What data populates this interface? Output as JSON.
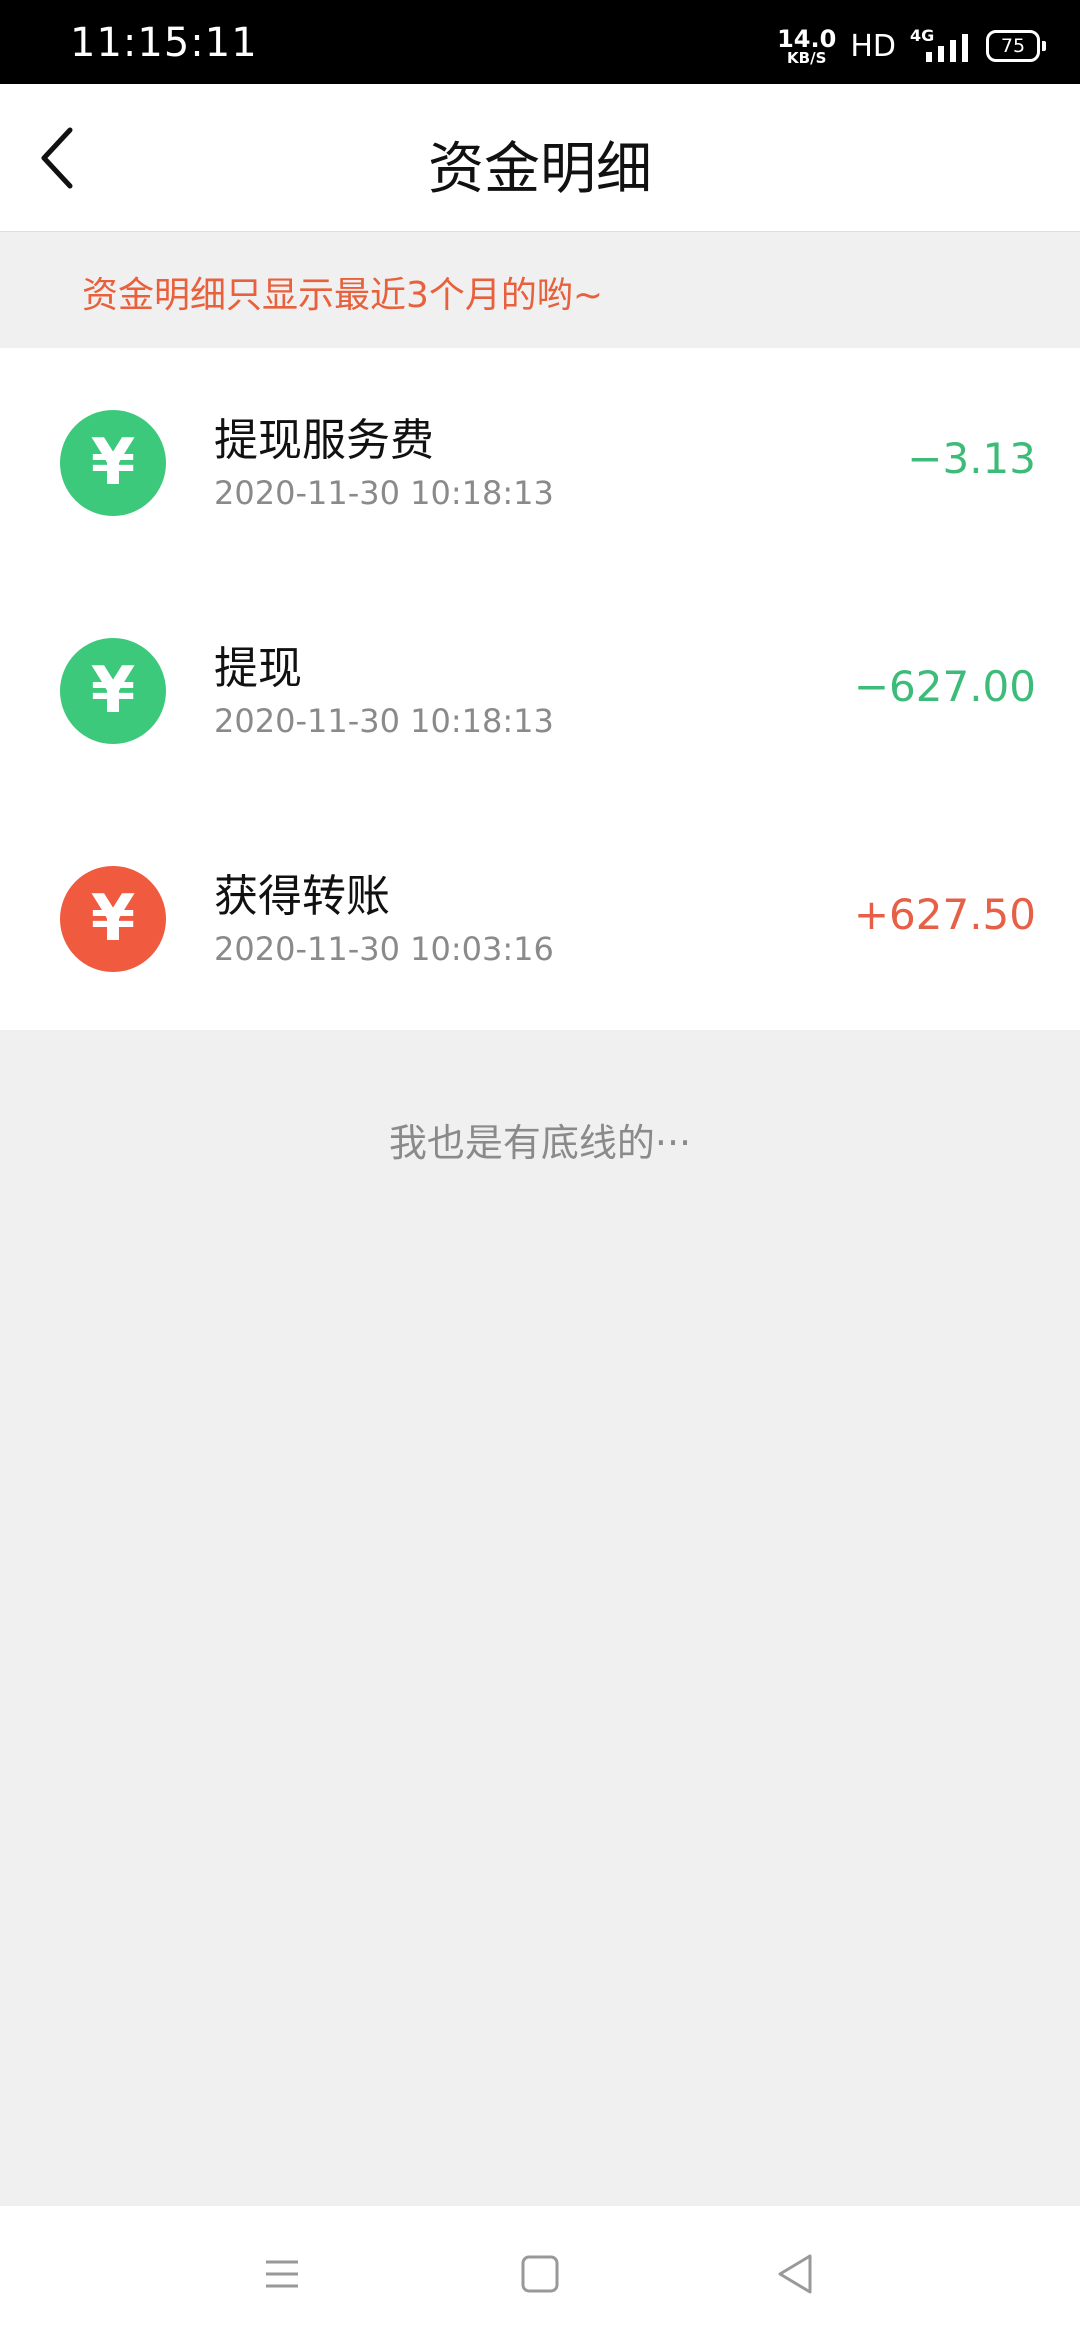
{
  "status_bar": {
    "time": "11:15:11",
    "net_speed_value": "14.0",
    "net_speed_unit": "KB/S",
    "hd": "HD",
    "network": "4G",
    "battery": "75"
  },
  "header": {
    "title": "资金明细",
    "back_icon": "chevron-left-icon"
  },
  "notice": "资金明细只显示最近3个月的哟~",
  "transactions": [
    {
      "title": "提现服务费",
      "time": "2020-11-30 10:18:13",
      "amount": "−3.13",
      "icon": "yuan-icon",
      "color": "#3dc97c"
    },
    {
      "title": "提现",
      "time": "2020-11-30 10:18:13",
      "amount": "−627.00",
      "icon": "yuan-icon",
      "color": "#3dc97c"
    },
    {
      "title": "获得转账",
      "time": "2020-11-30 10:03:16",
      "amount": "+627.50",
      "icon": "yuan-icon",
      "color": "#f05a3e"
    }
  ],
  "icon_glyph": "¥",
  "amount_colors": {
    "negative": "#3dbb79",
    "positive": "#e65f47"
  },
  "footer": "我也是有底线的···",
  "nav_bar": {
    "menu_icon": "menu-icon",
    "home_icon": "home-square-icon",
    "back_icon": "back-triangle-icon"
  }
}
